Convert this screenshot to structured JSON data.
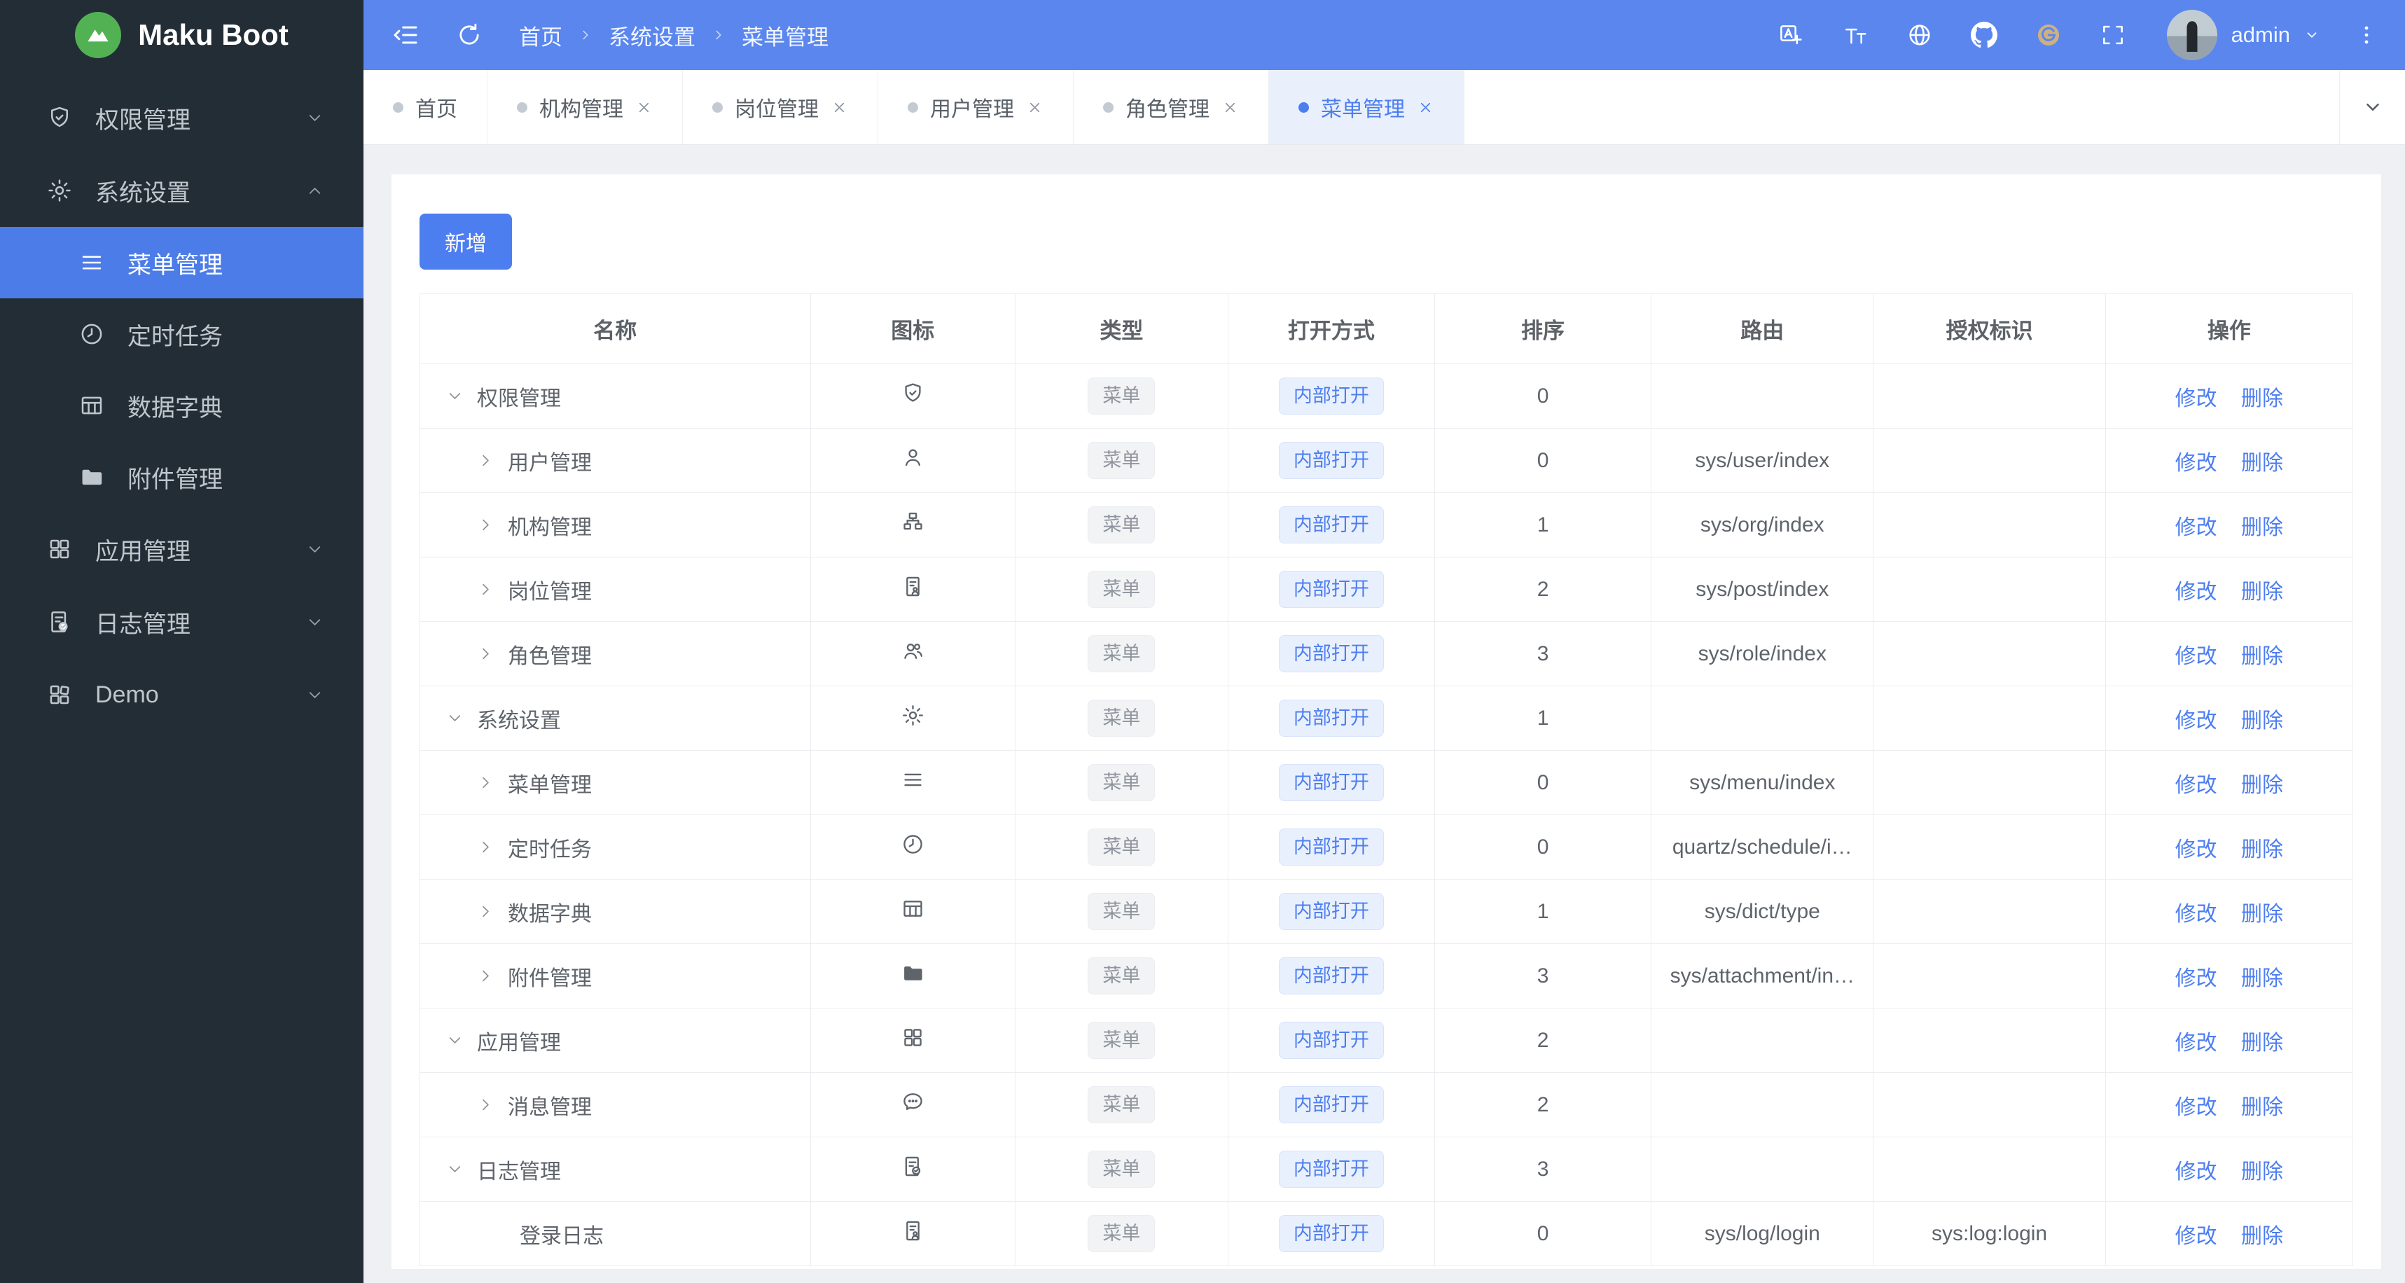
{
  "app": {
    "name": "Maku Boot"
  },
  "colors": {
    "primary": "#4d7ef0",
    "header_bg": "#5a86ee",
    "sidebar_bg": "#232d36",
    "sidebar_active_bg": "#4c7ce8",
    "logo_green": "#52b253",
    "tag_gray_bg": "#f2f3f5",
    "tag_blue_bg": "#e9f0fd",
    "gitee_icon": "#cdb183"
  },
  "header": {
    "breadcrumb": [
      "首页",
      "系统设置",
      "菜单管理"
    ],
    "tools": [
      "translate-icon",
      "font-size-icon",
      "globe-icon",
      "github-icon",
      "gitee-icon",
      "fullscreen-icon"
    ],
    "user": "admin"
  },
  "sidebar": {
    "items": [
      {
        "label": "权限管理",
        "icon": "shield-check-icon",
        "state": "collapsed"
      },
      {
        "label": "系统设置",
        "icon": "gear-icon",
        "state": "expanded",
        "children": [
          {
            "label": "菜单管理",
            "icon": "menu-lines-icon",
            "active": true
          },
          {
            "label": "定时任务",
            "icon": "clock-icon",
            "active": false
          },
          {
            "label": "数据字典",
            "icon": "dict-table-icon",
            "active": false
          },
          {
            "label": "附件管理",
            "icon": "folder-icon",
            "active": false
          }
        ]
      },
      {
        "label": "应用管理",
        "icon": "app-grid-icon",
        "state": "collapsed"
      },
      {
        "label": "日志管理",
        "icon": "log-doc-icon",
        "state": "collapsed"
      },
      {
        "label": "Demo",
        "icon": "demo-grid-icon",
        "state": "collapsed"
      }
    ]
  },
  "tabs": [
    {
      "label": "首页",
      "closable": false,
      "active": false
    },
    {
      "label": "机构管理",
      "closable": true,
      "active": false
    },
    {
      "label": "岗位管理",
      "closable": true,
      "active": false
    },
    {
      "label": "用户管理",
      "closable": true,
      "active": false
    },
    {
      "label": "角色管理",
      "closable": true,
      "active": false
    },
    {
      "label": "菜单管理",
      "closable": true,
      "active": true
    }
  ],
  "toolbar": {
    "add_label": "新增"
  },
  "table": {
    "columns": [
      "名称",
      "图标",
      "类型",
      "打开方式",
      "排序",
      "路由",
      "授权标识",
      "操作"
    ],
    "actions": [
      "修改",
      "删除"
    ],
    "rows": [
      {
        "name": "权限管理",
        "icon": "shield-check-icon",
        "level": 0,
        "expand": "down",
        "type": "菜单",
        "open": "内部打开",
        "sort": "0",
        "route": "",
        "auth": ""
      },
      {
        "name": "用户管理",
        "icon": "user-icon",
        "level": 1,
        "expand": "right",
        "type": "菜单",
        "open": "内部打开",
        "sort": "0",
        "route": "sys/user/index",
        "auth": ""
      },
      {
        "name": "机构管理",
        "icon": "org-icon",
        "level": 1,
        "expand": "right",
        "type": "菜单",
        "open": "内部打开",
        "sort": "1",
        "route": "sys/org/index",
        "auth": ""
      },
      {
        "name": "岗位管理",
        "icon": "id-card-icon",
        "level": 1,
        "expand": "right",
        "type": "菜单",
        "open": "内部打开",
        "sort": "2",
        "route": "sys/post/index",
        "auth": ""
      },
      {
        "name": "角色管理",
        "icon": "roles-icon",
        "level": 1,
        "expand": "right",
        "type": "菜单",
        "open": "内部打开",
        "sort": "3",
        "route": "sys/role/index",
        "auth": ""
      },
      {
        "name": "系统设置",
        "icon": "gear-icon",
        "level": 0,
        "expand": "down",
        "type": "菜单",
        "open": "内部打开",
        "sort": "1",
        "route": "",
        "auth": ""
      },
      {
        "name": "菜单管理",
        "icon": "menu-lines-icon",
        "level": 1,
        "expand": "right",
        "type": "菜单",
        "open": "内部打开",
        "sort": "0",
        "route": "sys/menu/index",
        "auth": ""
      },
      {
        "name": "定时任务",
        "icon": "clock-icon",
        "level": 1,
        "expand": "right",
        "type": "菜单",
        "open": "内部打开",
        "sort": "0",
        "route": "quartz/schedule/i…",
        "auth": ""
      },
      {
        "name": "数据字典",
        "icon": "dict-table-icon",
        "level": 1,
        "expand": "right",
        "type": "菜单",
        "open": "内部打开",
        "sort": "1",
        "route": "sys/dict/type",
        "auth": ""
      },
      {
        "name": "附件管理",
        "icon": "folder-icon",
        "level": 1,
        "expand": "right",
        "type": "菜单",
        "open": "内部打开",
        "sort": "3",
        "route": "sys/attachment/in…",
        "auth": ""
      },
      {
        "name": "应用管理",
        "icon": "app-grid-icon",
        "level": 0,
        "expand": "down",
        "type": "菜单",
        "open": "内部打开",
        "sort": "2",
        "route": "",
        "auth": ""
      },
      {
        "name": "消息管理",
        "icon": "message-icon",
        "level": 1,
        "expand": "right",
        "type": "菜单",
        "open": "内部打开",
        "sort": "2",
        "route": "",
        "auth": ""
      },
      {
        "name": "日志管理",
        "icon": "log-doc-icon",
        "level": 0,
        "expand": "down",
        "type": "菜单",
        "open": "内部打开",
        "sort": "3",
        "route": "",
        "auth": ""
      },
      {
        "name": "登录日志",
        "icon": "id-card-icon",
        "level": 2,
        "expand": "none",
        "type": "菜单",
        "open": "内部打开",
        "sort": "0",
        "route": "sys/log/login",
        "auth": "sys:log:login"
      }
    ]
  }
}
